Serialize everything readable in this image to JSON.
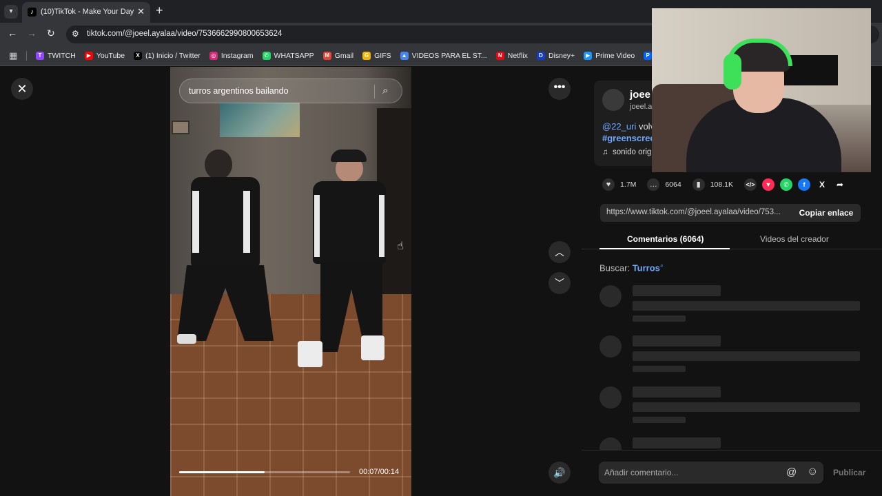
{
  "browser": {
    "tab": {
      "title": "(10)TikTok - Make Your Day",
      "favicon": "tiktok-icon"
    },
    "url": "tiktok.com/@joeel.ayalaa/video/7536662990800653624",
    "bookmarks": [
      {
        "label": "TWITCH",
        "color": "#9146ff",
        "glyph": "T"
      },
      {
        "label": "YouTube",
        "color": "#ff0000",
        "glyph": "▶"
      },
      {
        "label": "(1) Inicio / Twitter",
        "color": "#000000",
        "glyph": "X"
      },
      {
        "label": "Instagram",
        "color": "#d62976",
        "glyph": "◎"
      },
      {
        "label": "WHATSAPP",
        "color": "#25d366",
        "glyph": "✆"
      },
      {
        "label": "Gmail",
        "color": "#ea4335",
        "glyph": "M"
      },
      {
        "label": "GIFS",
        "color": "#f4b400",
        "glyph": "G"
      },
      {
        "label": "VIDEOS PARA EL ST...",
        "color": "#4285f4",
        "glyph": "▲"
      },
      {
        "label": "Netflix",
        "color": "#e50914",
        "glyph": "N"
      },
      {
        "label": "Disney+",
        "color": "#113ccf",
        "glyph": "D"
      },
      {
        "label": "Prime Video",
        "color": "#1a98ff",
        "glyph": "▶"
      },
      {
        "label": "Paramount+",
        "color": "#0064ff",
        "glyph": "P"
      }
    ]
  },
  "video": {
    "search_query": "turros argentinos bailando",
    "time": "00:07/00:14",
    "progress": 0.5
  },
  "creator": {
    "name": "joee",
    "handle": "joeel.a",
    "mention": "@22_uri",
    "desc_rest": " volv",
    "hashtag": "#greenscree",
    "sound": "sonido orig"
  },
  "actions": {
    "likes": "1.7M",
    "comments": "6064",
    "saves": "108.1K"
  },
  "share": {
    "link": "https://www.tiktok.com/@joeel.ayalaa/video/753...",
    "copy_label": "Copiar enlace"
  },
  "tabs": {
    "comments": "Comentarios (6064)",
    "creator_videos": "Videos del creador"
  },
  "search_suggest": {
    "label": "Buscar:",
    "term": "Turros"
  },
  "comment_box": {
    "placeholder": "Añadir comentario...",
    "publish": "Publicar"
  }
}
